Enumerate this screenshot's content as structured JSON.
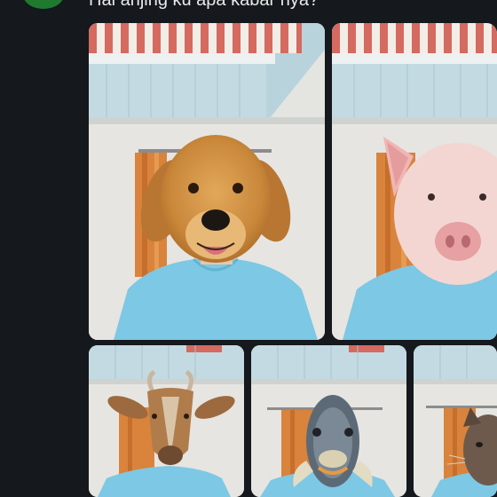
{
  "post": {
    "text": "Hai anjing ku apa kabar nya?"
  },
  "media": {
    "images": [
      {
        "subject": "dog-head"
      },
      {
        "subject": "pig-head"
      },
      {
        "subject": "goat-head"
      },
      {
        "subject": "fish-head"
      },
      {
        "subject": "animal-head-partial"
      }
    ]
  },
  "colors": {
    "background": "#15181c",
    "text": "#e7e9ea",
    "awning_red": "#d66a62",
    "shirt_blue": "#7dc8e4",
    "curtain_orange": "#d9833c"
  }
}
